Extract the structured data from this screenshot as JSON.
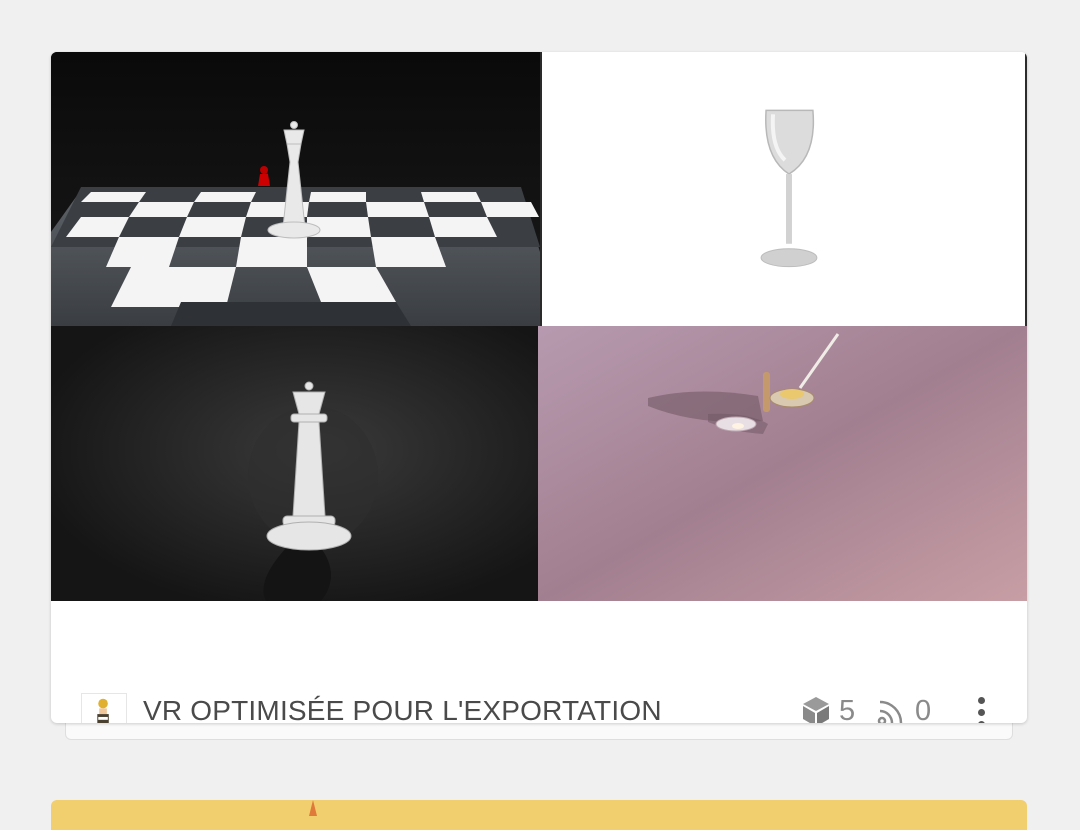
{
  "collection": {
    "title": "VR OPTIMISÉE POUR L'EXPORTATION",
    "models_count": "5",
    "followers_count": "0",
    "thumbnails": [
      {
        "name": "chess-board-queen"
      },
      {
        "name": "wine-glass"
      },
      {
        "name": "chess-queen"
      },
      {
        "name": "still-life-plates"
      }
    ],
    "icons": {
      "models": "cube-icon",
      "followers": "rss-icon",
      "menu": "more-vert-icon"
    }
  },
  "colors": {
    "background": "#f0f0f0",
    "card": "#ffffff",
    "text": "#4a4a4a",
    "muted": "#8a8a8a",
    "next_card": "#f2cf6e"
  }
}
